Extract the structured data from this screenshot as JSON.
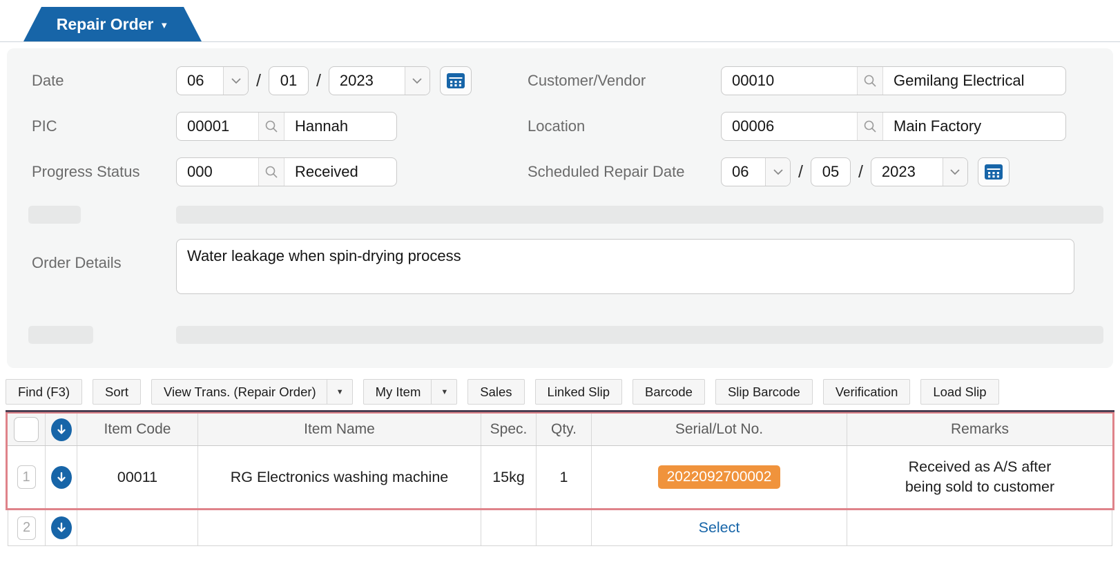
{
  "tab": {
    "label": "Repair Order"
  },
  "form": {
    "date": {
      "label": "Date",
      "month": "06",
      "day": "01",
      "year": "2023",
      "separator": "/"
    },
    "customer": {
      "label": "Customer/Vendor",
      "code": "00010",
      "name": "Gemilang Electrical"
    },
    "pic": {
      "label": "PIC",
      "code": "00001",
      "name": "Hannah"
    },
    "location": {
      "label": "Location",
      "code": "00006",
      "name": "Main Factory"
    },
    "progress": {
      "label": "Progress Status",
      "code": "000",
      "name": "Received"
    },
    "scheduled": {
      "label": "Scheduled Repair Date",
      "month": "06",
      "day": "05",
      "year": "2023",
      "separator": "/"
    },
    "order_details": {
      "label": "Order Details",
      "value": "Water leakage when spin-drying process"
    }
  },
  "toolbar": {
    "buttons": [
      {
        "label": "Find (F3)",
        "dropdown": false
      },
      {
        "label": "Sort",
        "dropdown": false
      },
      {
        "label": "View Trans. (Repair Order)",
        "dropdown": true
      },
      {
        "label": "My Item",
        "dropdown": true
      },
      {
        "label": "Sales",
        "dropdown": false
      },
      {
        "label": "Linked Slip",
        "dropdown": false
      },
      {
        "label": "Barcode",
        "dropdown": false
      },
      {
        "label": "Slip Barcode",
        "dropdown": false
      },
      {
        "label": "Verification",
        "dropdown": false
      },
      {
        "label": "Load Slip",
        "dropdown": false
      }
    ]
  },
  "grid": {
    "headers": [
      "Item Code",
      "Item Name",
      "Spec.",
      "Qty.",
      "Serial/Lot No.",
      "Remarks"
    ],
    "rows": [
      {
        "row_no": "1",
        "item_code": "00011",
        "item_name": "RG Electronics washing machine",
        "spec": "15kg",
        "qty": "1",
        "serial": "2022092700002",
        "remarks": "Received as A/S after being sold to customer"
      },
      {
        "row_no": "2",
        "item_code": "",
        "item_name": "",
        "spec": "",
        "qty": "",
        "serial_link": "Select",
        "remarks": ""
      }
    ]
  },
  "colors": {
    "accent_blue": "#1765a8",
    "badge_orange": "#f0933c",
    "highlight_red": "#df838a",
    "table_top": "#4a3e52"
  }
}
